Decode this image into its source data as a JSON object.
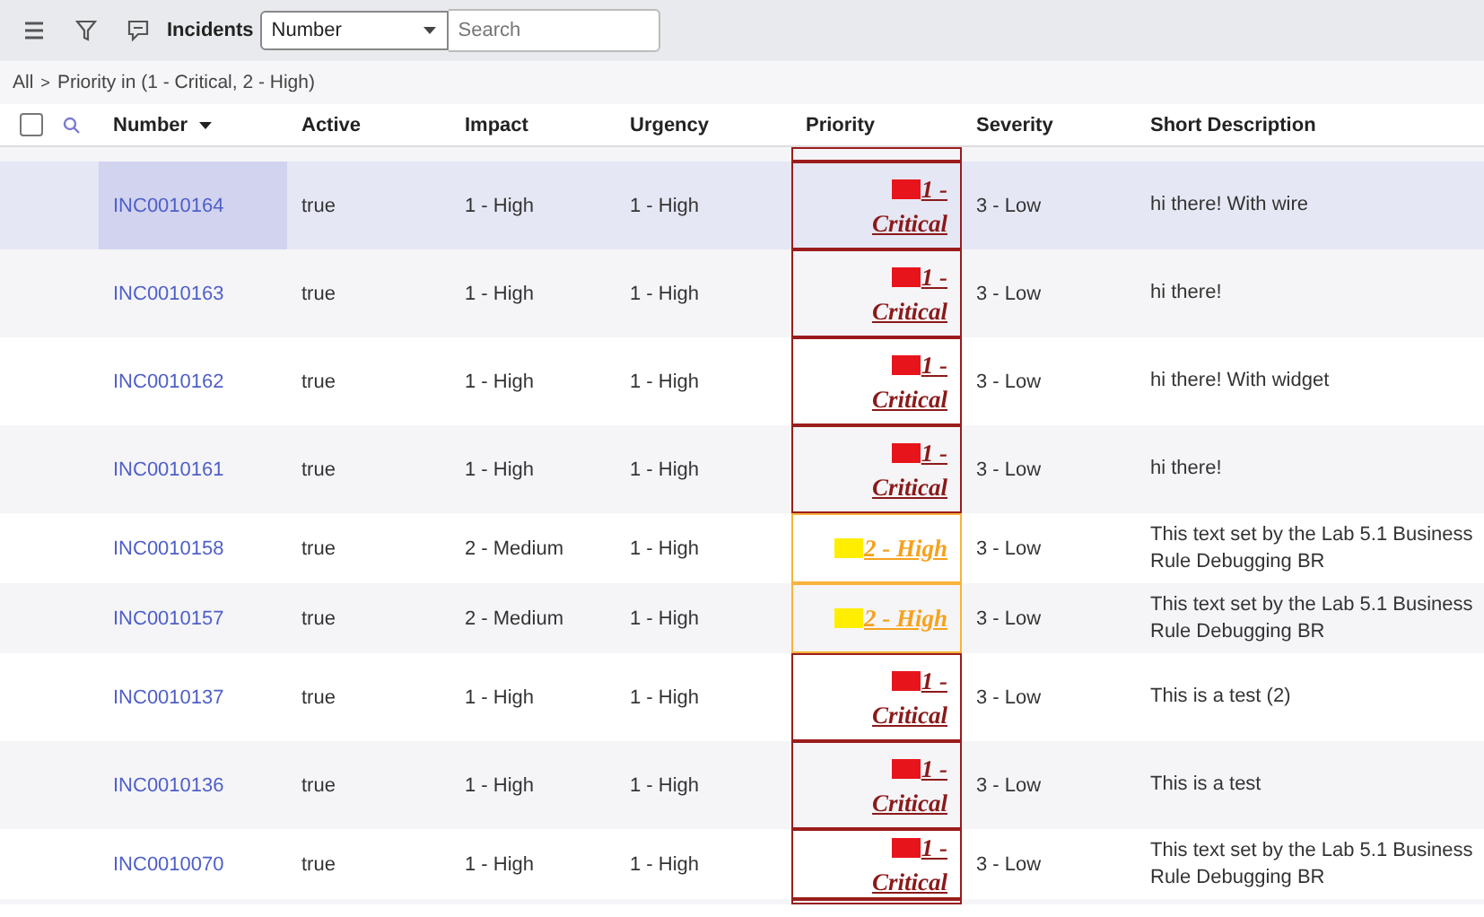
{
  "toolbar": {
    "title": "Incidents",
    "field_select": "Number",
    "search": {
      "placeholder": "Search"
    }
  },
  "breadcrumb": {
    "separator": ">",
    "items": [
      "All",
      "Priority in (1 - Critical, 2 - High)"
    ]
  },
  "select_all": {
    "checked": false
  },
  "columns": [
    {
      "label": "Number",
      "sorted": true
    },
    {
      "label": "Active",
      "sorted": false
    },
    {
      "label": "Impact",
      "sorted": false
    },
    {
      "label": "Urgency",
      "sorted": false
    },
    {
      "label": "Priority",
      "sorted": false
    },
    {
      "label": "Severity",
      "sorted": false
    },
    {
      "label": "Short Description",
      "sorted": false
    }
  ],
  "rows": [
    {
      "number": "INC0010164",
      "active": "true",
      "impact": "1 - High",
      "urgency": "1 - High",
      "priority": {
        "kind": "critical",
        "label": "1 - Critical"
      },
      "severity": "3 - Low",
      "description": "hi there! With wire",
      "selected": true
    },
    {
      "number": "INC0010163",
      "active": "true",
      "impact": "1 - High",
      "urgency": "1 - High",
      "priority": {
        "kind": "critical",
        "label": "1 - Critical"
      },
      "severity": "3 - Low",
      "description": "hi there!",
      "selected": false
    },
    {
      "number": "INC0010162",
      "active": "true",
      "impact": "1 - High",
      "urgency": "1 - High",
      "priority": {
        "kind": "critical",
        "label": "1 - Critical"
      },
      "severity": "3 - Low",
      "description": "hi there! With widget",
      "selected": false
    },
    {
      "number": "INC0010161",
      "active": "true",
      "impact": "1 - High",
      "urgency": "1 - High",
      "priority": {
        "kind": "critical",
        "label": "1 - Critical"
      },
      "severity": "3 - Low",
      "description": "hi there!",
      "selected": false
    },
    {
      "number": "INC0010158",
      "active": "true",
      "impact": "2 - Medium",
      "urgency": "1 - High",
      "priority": {
        "kind": "high",
        "label": "2 - High"
      },
      "severity": "3 - Low",
      "description": "This text set by the Lab 5.1 Business Rule Debugging BR",
      "selected": false
    },
    {
      "number": "INC0010157",
      "active": "true",
      "impact": "2 - Medium",
      "urgency": "1 - High",
      "priority": {
        "kind": "high",
        "label": "2 - High"
      },
      "severity": "3 - Low",
      "description": "This text set by the Lab 5.1 Business Rule Debugging BR",
      "selected": false
    },
    {
      "number": "INC0010137",
      "active": "true",
      "impact": "1 - High",
      "urgency": "1 - High",
      "priority": {
        "kind": "critical",
        "label": "1 - Critical"
      },
      "severity": "3 - Low",
      "description": "This is a test (2)",
      "selected": false
    },
    {
      "number": "INC0010136",
      "active": "true",
      "impact": "1 - High",
      "urgency": "1 - High",
      "priority": {
        "kind": "critical",
        "label": "1 - Critical"
      },
      "severity": "3 - Low",
      "description": "This is a test",
      "selected": false
    },
    {
      "number": "INC0010070",
      "active": "true",
      "impact": "1 - High",
      "urgency": "1 - High",
      "priority": {
        "kind": "critical",
        "label": "1 - Critical"
      },
      "severity": "3 - Low",
      "description": "This text set by the Lab 5.1 Business Rule Debugging BR",
      "selected": false
    }
  ]
}
